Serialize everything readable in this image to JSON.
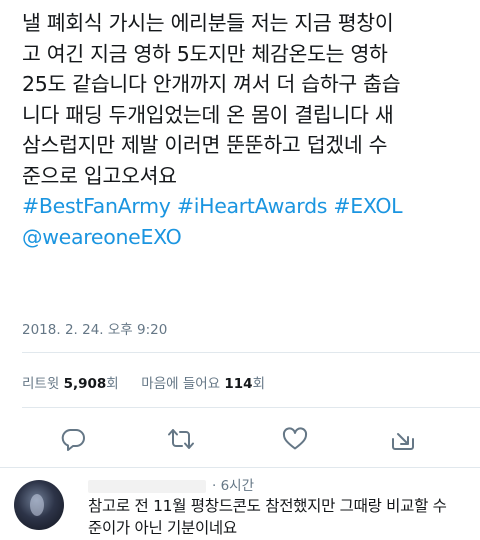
{
  "tweet": {
    "lines": [
      "낼 폐회식 가시는 에리분들 저는 지금 평창이",
      "고 여긴 지금 영하 5도지만 체감온도는 영하",
      "25도 같습니다 안개까지 껴서 더 습하구 춥습",
      "니다 패딩 두개입었는데 온 몸이 결립니다 새",
      "삼스럽지만 제발 이러면 뚠뚠하고 덥겠네 수",
      "준으로 입고오셔요"
    ],
    "hashtags_line1": "#BestFanArmy #iHeartAwards #EXOL",
    "hashtags_line2": "@weareoneEXO",
    "timestamp": "2018. 2. 24. 오후 9:20"
  },
  "stats": {
    "retweets_label": "리트윗",
    "retweets_count": "5,908",
    "retweets_unit": "회",
    "likes_label": "마음에 들어요",
    "likes_count": "114",
    "likes_unit": "회"
  },
  "actions": [
    {
      "name": "reply",
      "icon": "reply-icon"
    },
    {
      "name": "retweet",
      "icon": "retweet-icon"
    },
    {
      "name": "like",
      "icon": "heart-icon"
    },
    {
      "name": "share",
      "icon": "share-icon"
    }
  ],
  "reply": {
    "time": "· 6시간",
    "lines": [
      "참고로 전 11월 평창드콘도 참전했지만 그때랑 비교할 수",
      "준이가 아닌 기분이네요"
    ]
  },
  "colors": {
    "link": "#1b95e0",
    "secondary_text": "#657786",
    "icon": "#657786",
    "divider": "#e1e8ed"
  }
}
